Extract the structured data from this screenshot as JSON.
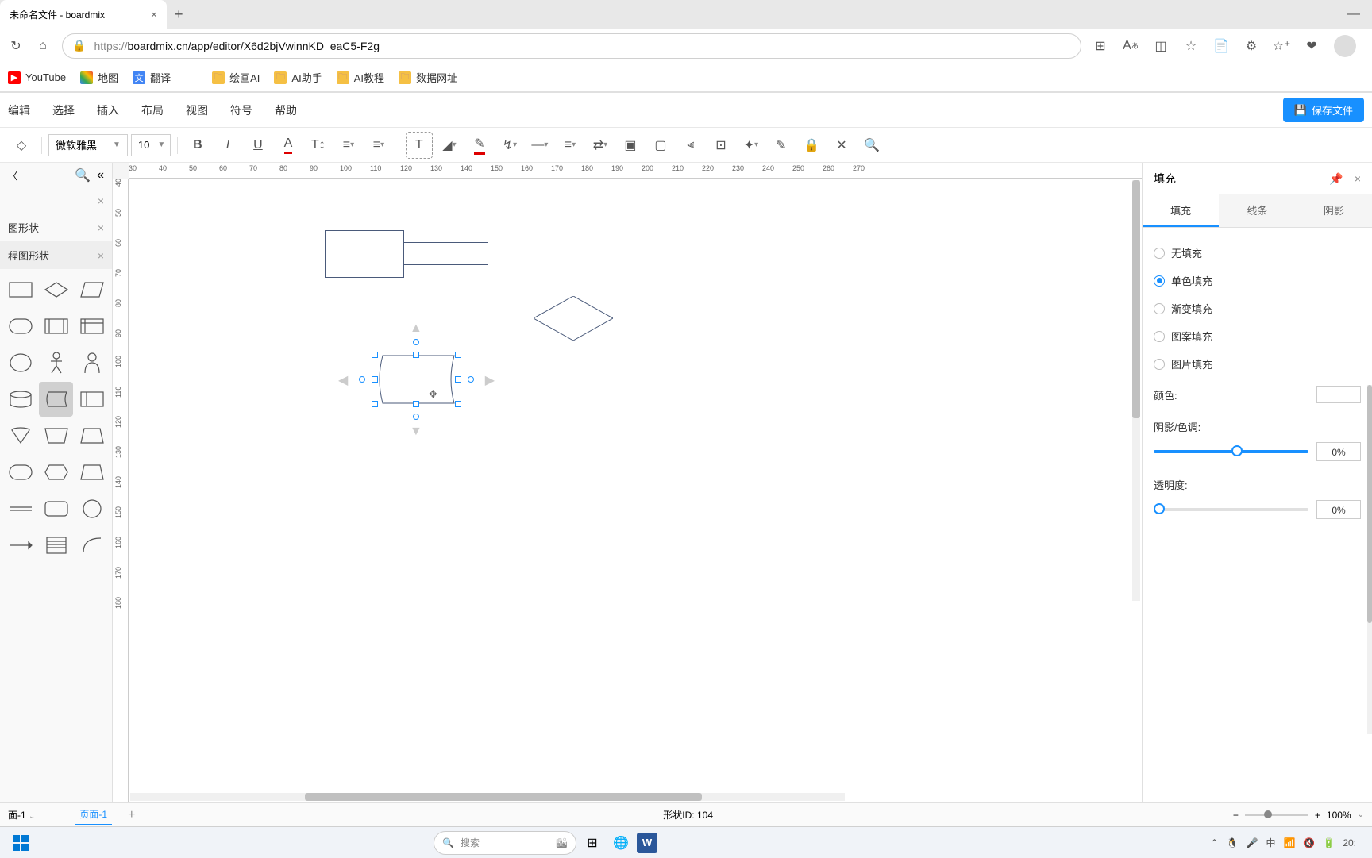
{
  "browser": {
    "tab_title": "未命名文件 - boardmix",
    "url_display": "boardmix.cn/app/editor/X6d2bjVwinnKD_eaC5-F2g",
    "url_prefix": "https://"
  },
  "bookmarks": [
    {
      "label": "YouTube",
      "icon": "yt"
    },
    {
      "label": "地图",
      "icon": "map"
    },
    {
      "label": "翻译",
      "icon": "trans"
    },
    {
      "label": "",
      "icon": "slack"
    },
    {
      "label": "绘画AI",
      "icon": "folder"
    },
    {
      "label": "AI助手",
      "icon": "folder"
    },
    {
      "label": "AI教程",
      "icon": "folder"
    },
    {
      "label": "数据网址",
      "icon": "folder"
    }
  ],
  "menubar": [
    "编辑",
    "选择",
    "插入",
    "布局",
    "视图",
    "符号",
    "帮助"
  ],
  "save_button": "保存文件",
  "toolbar": {
    "font": "微软雅黑",
    "size": "10"
  },
  "left_panel": {
    "section1": "图形状",
    "section2": "程图形状"
  },
  "ruler_h": [
    "30",
    "40",
    "50",
    "60",
    "70",
    "80",
    "90",
    "100",
    "110",
    "120",
    "130",
    "140",
    "150",
    "160",
    "170",
    "180",
    "190",
    "200",
    "210",
    "220",
    "230",
    "240",
    "250",
    "260",
    "270"
  ],
  "ruler_v": [
    "40",
    "50",
    "60",
    "70",
    "80",
    "90",
    "100",
    "110",
    "120",
    "130",
    "140",
    "150",
    "160",
    "170",
    "180"
  ],
  "right_panel": {
    "title": "填充",
    "tabs": [
      "填充",
      "线条",
      "阴影"
    ],
    "fill_options": [
      "无填充",
      "单色填充",
      "渐变填充",
      "图案填充",
      "图片填充"
    ],
    "selected_fill": 1,
    "color_label": "颜色:",
    "shade_label": "阴影/色调:",
    "shade_value": "0%",
    "opacity_label": "透明度:",
    "opacity_value": "0%"
  },
  "status": {
    "page_dropdown": "面-1",
    "page_active": "页面-1",
    "shape_id": "形状ID: 104",
    "zoom": "100%"
  },
  "taskbar": {
    "search_placeholder": "搜索",
    "time": "20:"
  }
}
